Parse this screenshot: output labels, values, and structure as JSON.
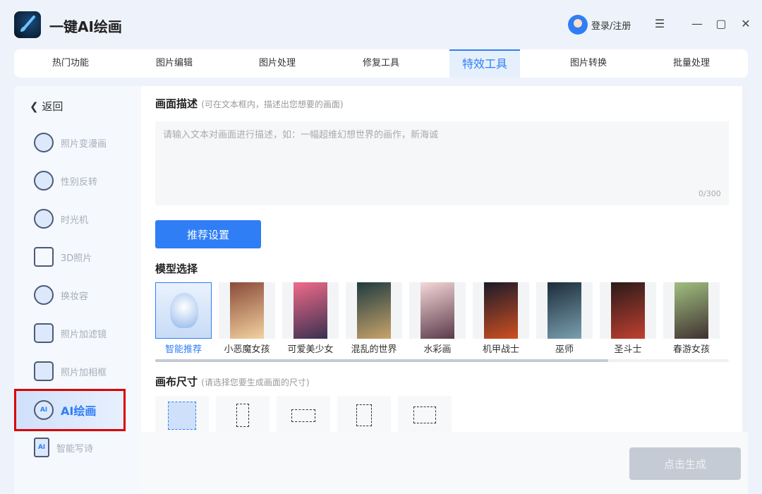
{
  "app": {
    "title": "一键AI绘画",
    "login": "登录/注册"
  },
  "icons": {
    "logo": "paintbrush-icon",
    "menu": "hamburger-icon",
    "min": "minimize-icon",
    "max": "maximize-icon",
    "close": "close-icon"
  },
  "tabs": [
    "热门功能",
    "图片编辑",
    "图片处理",
    "修复工具",
    "特效工具",
    "图片转换",
    "批量处理"
  ],
  "active_tab": "特效工具",
  "sidebar": {
    "back": "返回",
    "items": [
      {
        "label": "照片变漫画",
        "icon": "bear-face-icon"
      },
      {
        "label": "性别反转",
        "icon": "gender-icon"
      },
      {
        "label": "时光机",
        "icon": "clock-icon"
      },
      {
        "label": "3D照片",
        "icon": "layers-icon"
      },
      {
        "label": "换妆容",
        "icon": "face-icon"
      },
      {
        "label": "照片加滤镜",
        "icon": "filter-icon"
      },
      {
        "label": "照片加相框",
        "icon": "frame-icon"
      },
      {
        "label": "AI绘画",
        "icon": "ai-palette-icon"
      },
      {
        "label": "智能写诗",
        "icon": "ai-doc-icon"
      }
    ]
  },
  "main": {
    "desc_title": "画面描述",
    "desc_hint": "(可在文本框内，描述出您想要的画面)",
    "desc_placeholder": "请输入文本对画面进行描述，如：一幅超维幻想世界的画作，新海诚",
    "count": "0/300",
    "recommend": "推荐设置",
    "model_title": "模型选择",
    "models": [
      "智能推荐",
      "小恶魔女孩",
      "可爱美少女",
      "混乱的世界",
      "水彩画",
      "机甲战士",
      "巫师",
      "圣斗士",
      "春游女孩"
    ],
    "selected_model": "智能推荐",
    "canvas_title": "画布尺寸",
    "canvas_hint": "(请选择您要生成画面的尺寸)",
    "generate": "点击生成"
  },
  "colors": {
    "accent": "#2f7ef5",
    "highlight": "#d90000"
  }
}
